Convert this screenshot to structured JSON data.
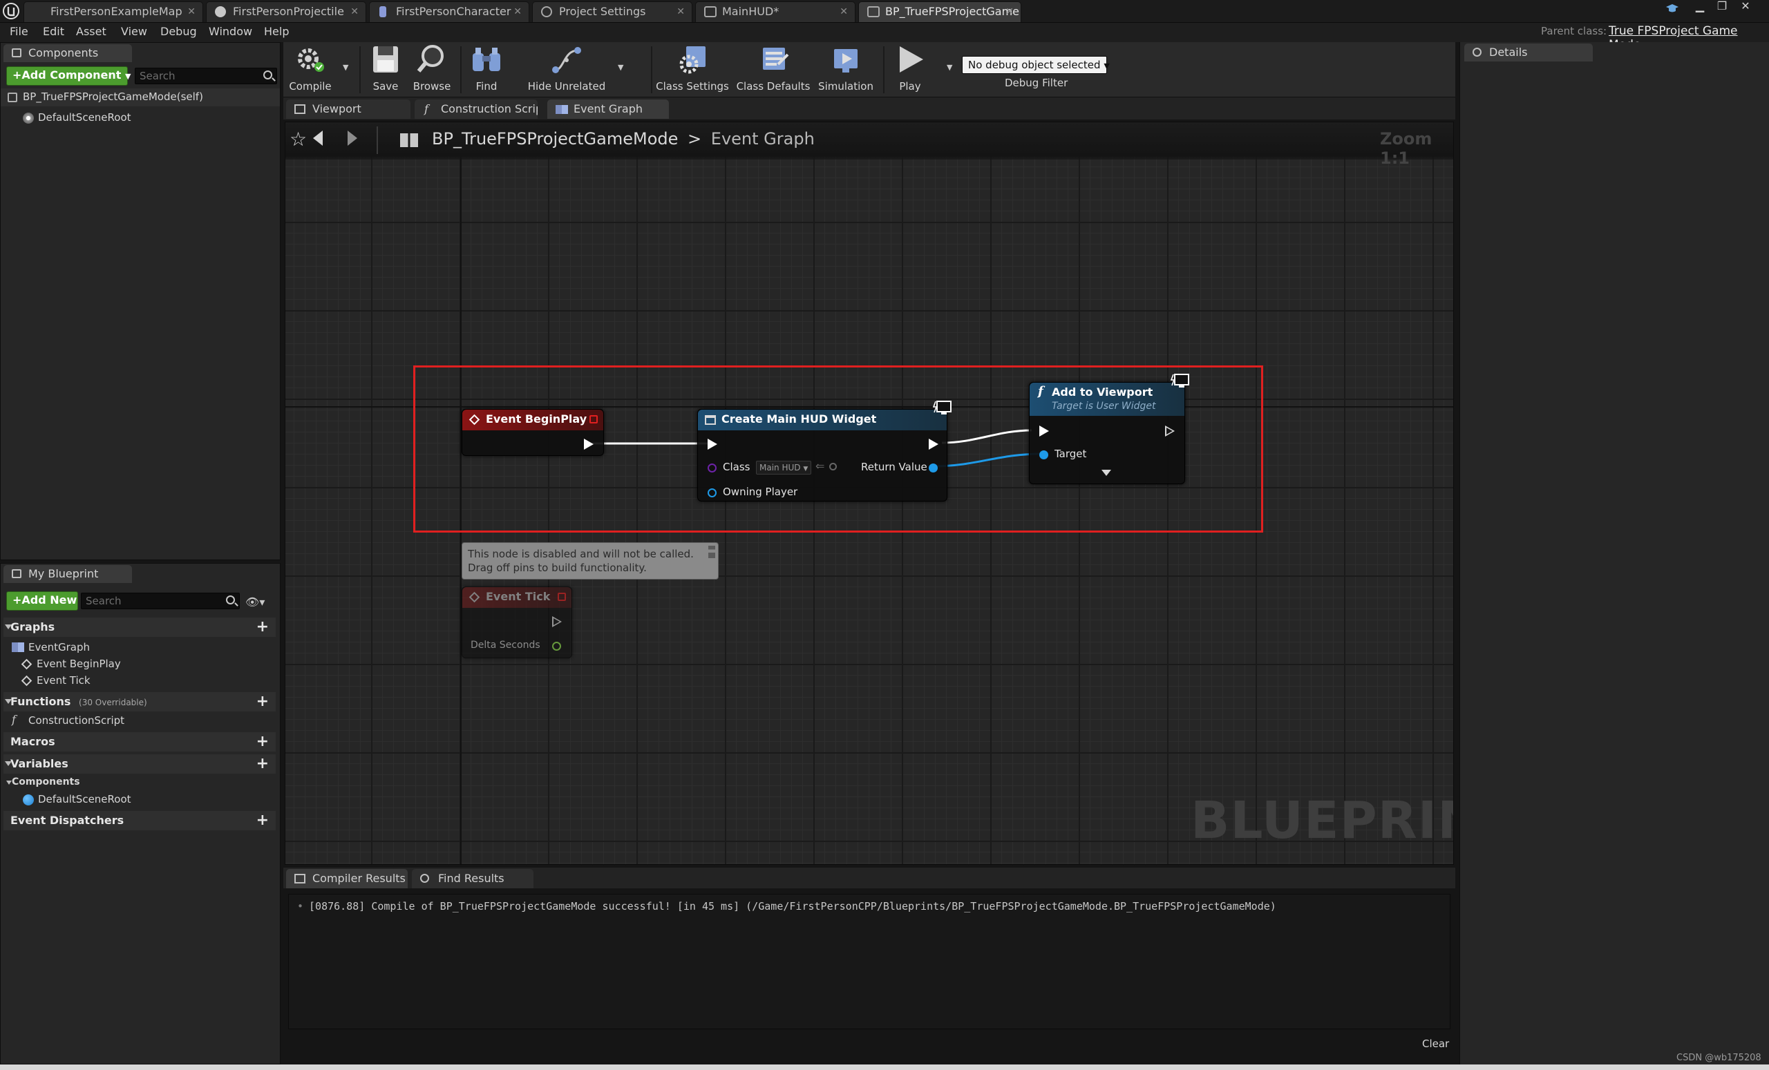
{
  "document_tabs": [
    {
      "label": "FirstPersonExampleMap"
    },
    {
      "label": "FirstPersonProjectile"
    },
    {
      "label": "FirstPersonCharacter"
    },
    {
      "label": "Project Settings"
    },
    {
      "label": "MainHUD*"
    },
    {
      "label": "BP_TrueFPSProjectGame"
    }
  ],
  "menu": [
    "File",
    "Edit",
    "Asset",
    "View",
    "Debug",
    "Window",
    "Help"
  ],
  "parent_class": {
    "label": "Parent class:",
    "value": "True FPSProject Game Mode"
  },
  "components_panel": {
    "tab": "Components",
    "add_button": "+Add Component",
    "search_placeholder": "Search",
    "root": "BP_TrueFPSProjectGameMode(self)",
    "child": "DefaultSceneRoot"
  },
  "toolbar": {
    "compile": "Compile",
    "save": "Save",
    "browse": "Browse",
    "find": "Find",
    "hide_unrelated": "Hide Unrelated",
    "class_settings": "Class Settings",
    "class_defaults": "Class Defaults",
    "simulation": "Simulation",
    "play": "Play",
    "debug_select": "No debug object selected",
    "debug_filter": "Debug Filter"
  },
  "graph_tabs": [
    {
      "label": "Viewport"
    },
    {
      "label": "Construction Scrip"
    },
    {
      "label": "Event Graph"
    }
  ],
  "graph": {
    "breadcrumb_root": "BP_TrueFPSProjectGameMode",
    "breadcrumb_sep": ">",
    "breadcrumb_leaf": "Event Graph",
    "zoom": "Zoom 1:1",
    "watermark": "BLUEPRINT",
    "colors": {
      "exec": "#ffffff",
      "object": "#1e9ae8",
      "class": "#6d23a8",
      "highlight": "#e02020",
      "event_head": "#8a1414",
      "function_head": "#1d4e72"
    }
  },
  "nodes": {
    "begin_play": {
      "title": "Event BeginPlay"
    },
    "create_widget": {
      "title": "Create Main HUD Widget",
      "class_label": "Class",
      "class_value": "Main HUD",
      "owning_player": "Owning Player",
      "return_value": "Return Value"
    },
    "add_to_viewport": {
      "title": "Add to Viewport",
      "subtitle": "Target is User Widget",
      "target": "Target"
    },
    "tick_tooltip": {
      "line1": "This node is disabled and will not be called.",
      "line2": "Drag off pins to build functionality."
    },
    "tick": {
      "title": "Event Tick",
      "delta": "Delta Seconds"
    }
  },
  "my_blueprint": {
    "tab": "My Blueprint",
    "add_button": "+Add New",
    "search_placeholder": "Search",
    "sections": {
      "graphs": "Graphs",
      "functions": "Functions",
      "functions_count": "(30 Overridable)",
      "macros": "Macros",
      "variables": "Variables",
      "components": "Components",
      "event_dispatchers": "Event Dispatchers"
    },
    "graph_items": [
      "EventGraph",
      "Event BeginPlay",
      "Event Tick"
    ],
    "function_items": [
      "ConstructionScript"
    ],
    "component_items": [
      "DefaultSceneRoot"
    ]
  },
  "output": {
    "tabs": [
      "Compiler Results",
      "Find Results"
    ],
    "log_line": "[0876.88] Compile of BP_TrueFPSProjectGameMode successful! [in 45 ms] (/Game/FirstPersonCPP/Blueprints/BP_TrueFPSProjectGameMode.BP_TrueFPSProjectGameMode)",
    "clear": "Clear"
  },
  "details_panel": {
    "tab": "Details"
  },
  "watermark_credit": "CSDN @wb175208"
}
